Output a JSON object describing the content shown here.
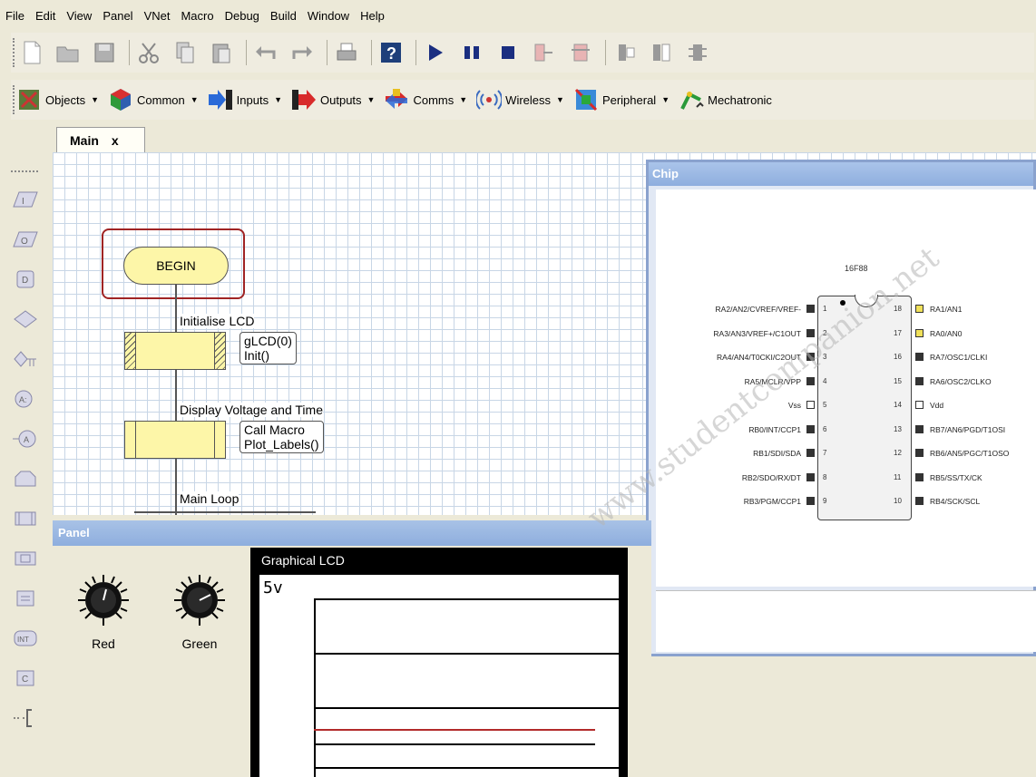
{
  "menu": [
    "File",
    "Edit",
    "View",
    "Panel",
    "VNet",
    "Macro",
    "Debug",
    "Build",
    "Window",
    "Help"
  ],
  "toolbar1": [
    "new-icon",
    "open-icon",
    "save-icon",
    "cut-icon",
    "copy-icon",
    "paste-icon",
    "undo-icon",
    "redo-icon",
    "print-icon",
    "help-icon",
    "run-icon",
    "pause-icon",
    "stop-icon",
    "step-into-icon",
    "step-over-icon",
    "component-1-icon",
    "component-2-icon",
    "component-3-icon"
  ],
  "toolbar2": {
    "categories": [
      {
        "label": "Objects",
        "icon": "objects-icon"
      },
      {
        "label": "Common",
        "icon": "common-icon"
      },
      {
        "label": "Inputs",
        "icon": "inputs-icon"
      },
      {
        "label": "Outputs",
        "icon": "outputs-icon"
      },
      {
        "label": "Comms",
        "icon": "comms-icon"
      },
      {
        "label": "Wireless",
        "icon": "wireless-icon"
      },
      {
        "label": "Peripheral",
        "icon": "peripheral-icon"
      },
      {
        "label": "Mechatronic",
        "icon": "mechatronic-icon"
      }
    ]
  },
  "tab": {
    "label": "Main",
    "close": "x"
  },
  "palette": [
    "input-icon",
    "output-icon",
    "delay-icon",
    "decision-icon",
    "switch-icon",
    "calc-icon",
    "connection-point-icon",
    "loop-icon",
    "macro-icon",
    "component-macro-icon",
    "string-icon",
    "interrupt-icon",
    "c-code-icon",
    "comment-icon"
  ],
  "flowchart": {
    "begin": "BEGIN",
    "step1_label": "Initialise LCD",
    "step1_note": [
      "gLCD(0)",
      "Init()"
    ],
    "step2_label": "Display Voltage and Time",
    "step2_note": [
      "Call Macro",
      "Plot_Labels()"
    ],
    "step3_label": "Main Loop"
  },
  "chip": {
    "title": "Chip",
    "part": "16F88",
    "left_pins": [
      "RA2/AN2/CVREF/VREF-",
      "RA3/AN3/VREF+/C1OUT",
      "RA4/AN4/T0CKI/C2OUT",
      "RA5/MCLR/VPP",
      "Vss",
      "RB0/INT/CCP1",
      "RB1/SDI/SDA",
      "RB2/SDO/RX/DT",
      "RB3/PGM/CCP1"
    ],
    "left_nums": [
      "1",
      "2",
      "3",
      "4",
      "5",
      "6",
      "7",
      "8",
      "9"
    ],
    "right_pins": [
      "RA1/AN1",
      "RA0/AN0",
      "RA7/OSC1/CLKI",
      "RA6/OSC2/CLKO",
      "Vdd",
      "RB7/AN6/PGD/T1OSI",
      "RB6/AN5/PGC/T1OSO",
      "RB5/SS/TX/CK",
      "RB4/SCK/SCL"
    ],
    "right_nums": [
      "18",
      "17",
      "16",
      "15",
      "14",
      "13",
      "12",
      "11",
      "10"
    ]
  },
  "panel": {
    "title": "Panel",
    "knobs": [
      {
        "label": "Red"
      },
      {
        "label": "Green"
      }
    ],
    "glcd_title": "Graphical LCD",
    "glcd_text": "5v"
  },
  "watermark": "www.studentcompanion.net"
}
